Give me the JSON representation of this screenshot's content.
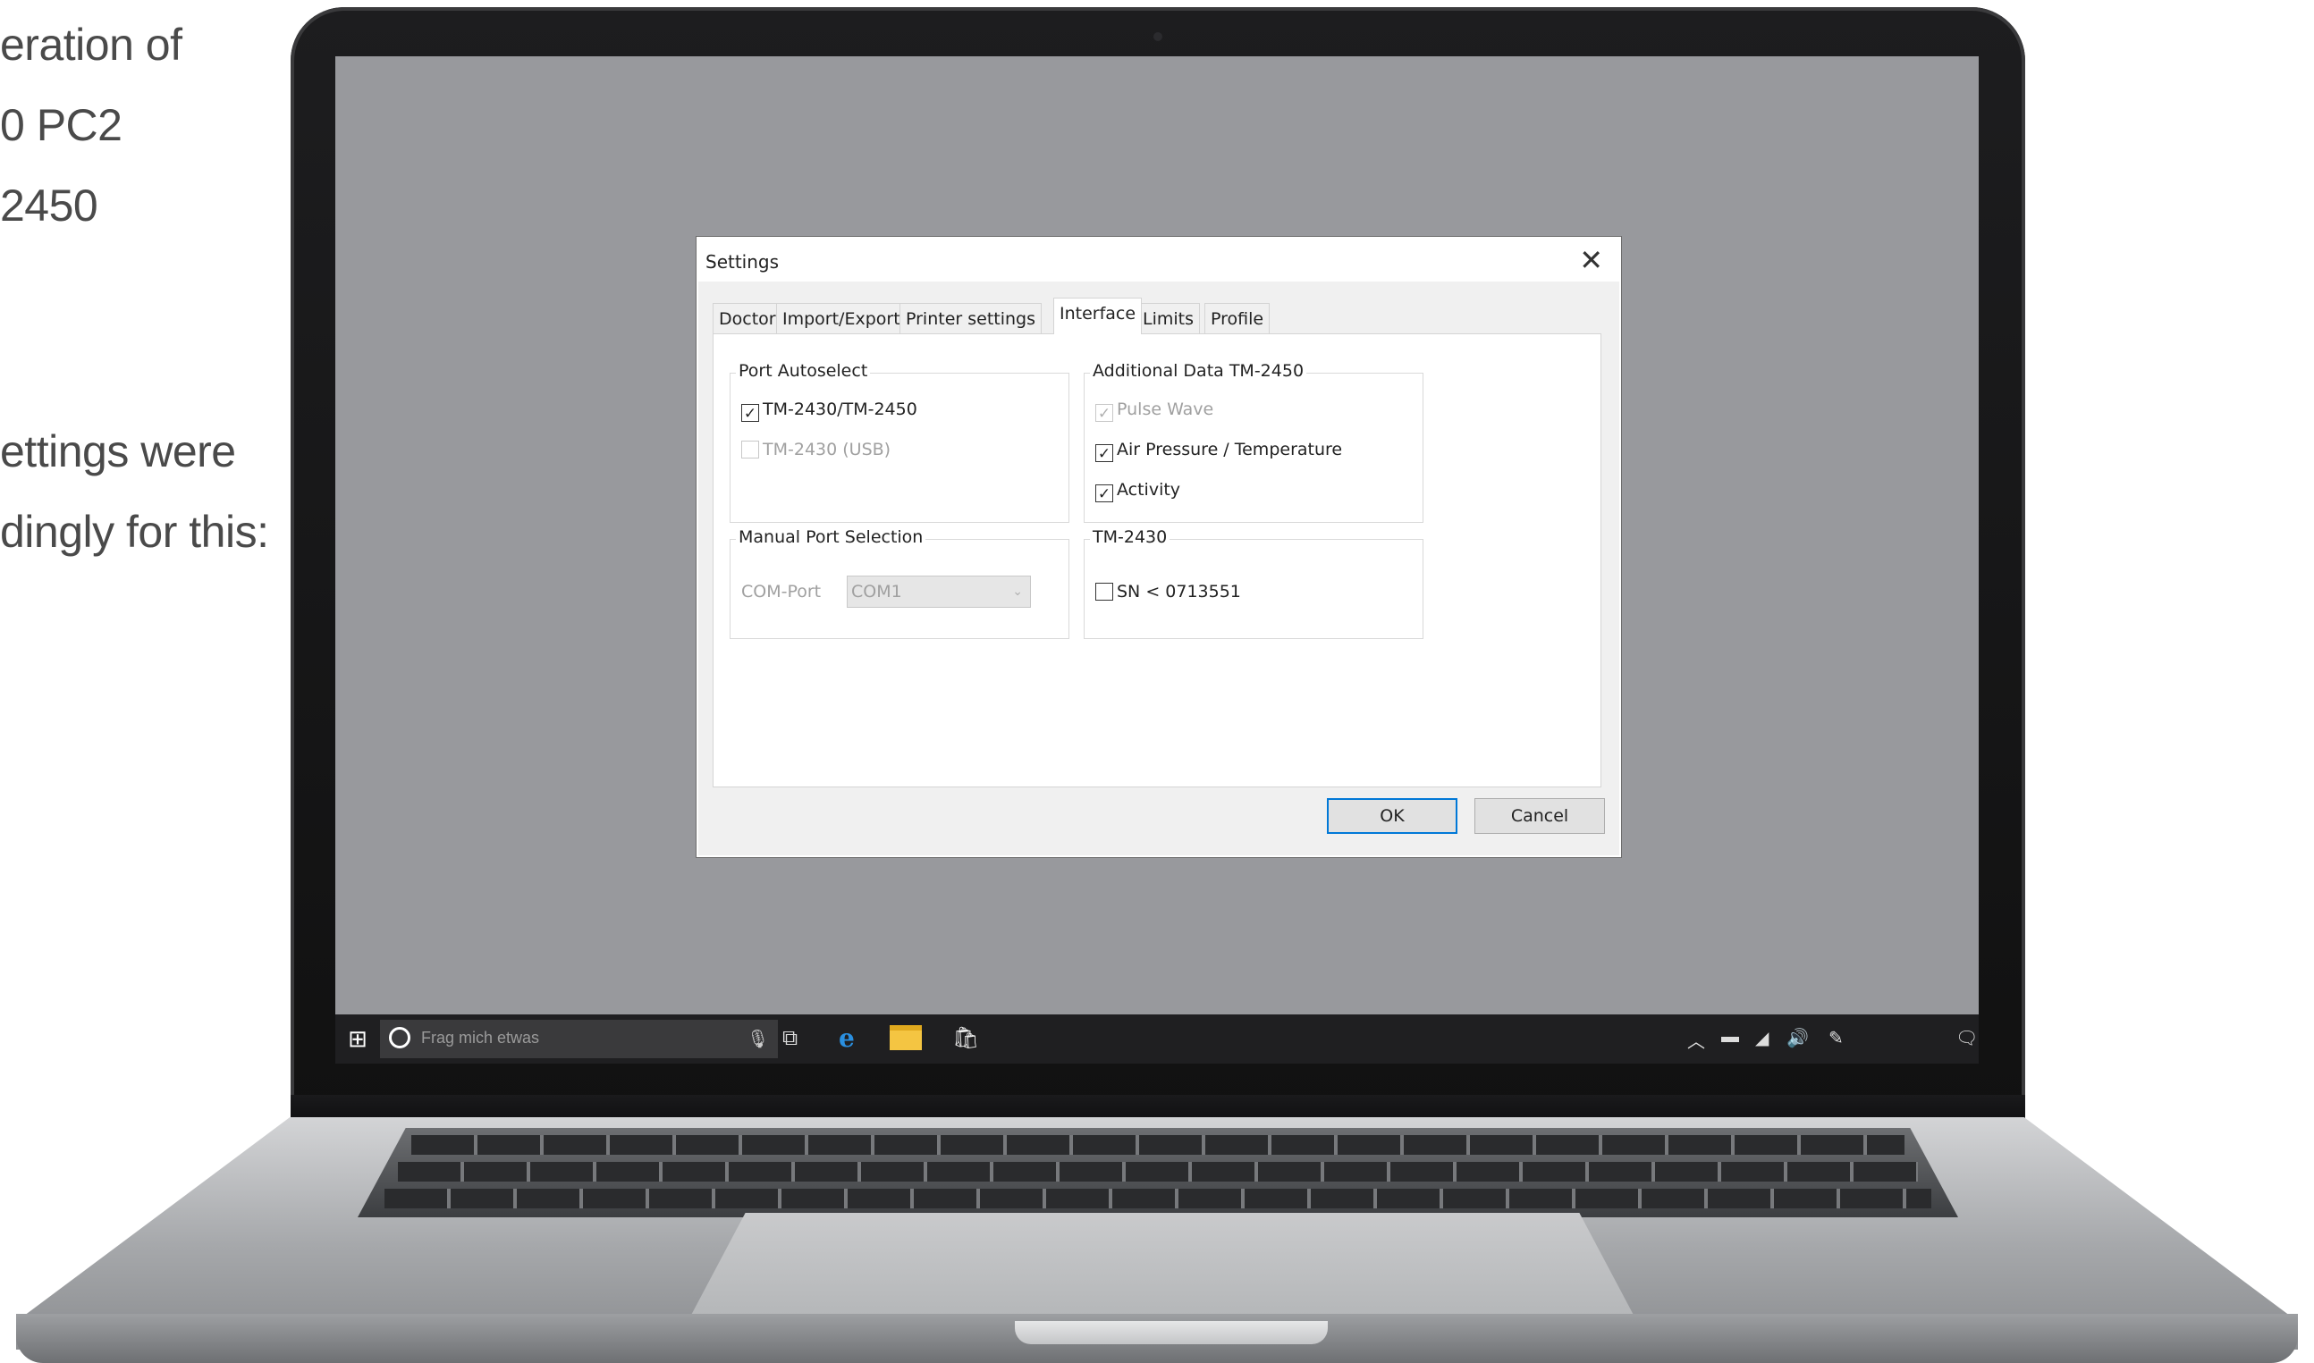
{
  "side_text": {
    "block1": [
      "eration of",
      "0 PC2",
      "2450"
    ],
    "block2": [
      "ettings were",
      "dingly for this:"
    ]
  },
  "dialog": {
    "title": "Settings",
    "close_glyph": "✕",
    "tabs": [
      {
        "label": "Doctor"
      },
      {
        "label": "Import/Export"
      },
      {
        "label": "Printer settings"
      },
      {
        "label": "Interface",
        "active": true
      },
      {
        "label": "Limits"
      },
      {
        "label": "Profile"
      }
    ],
    "port_autoselect": {
      "label": "Port Autoselect",
      "items": [
        {
          "label": "TM-2430/TM-2450",
          "checked": true,
          "enabled": true
        },
        {
          "label": "TM-2430 (USB)",
          "checked": false,
          "enabled": false
        }
      ]
    },
    "additional_data": {
      "label": "Additional Data TM-2450",
      "items": [
        {
          "label": "Pulse Wave",
          "checked": true,
          "enabled": false
        },
        {
          "label": "Air Pressure / Temperature",
          "checked": true,
          "enabled": true
        },
        {
          "label": "Activity",
          "checked": true,
          "enabled": true
        }
      ]
    },
    "manual_port": {
      "label": "Manual Port Selection",
      "com_label": "COM-Port",
      "com_value": "COM1"
    },
    "tm2430": {
      "label": "TM-2430",
      "items": [
        {
          "label": "SN < 0713551",
          "checked": false,
          "enabled": true
        }
      ]
    },
    "ok_label": "OK",
    "cancel_label": "Cancel"
  },
  "taskbar": {
    "search_placeholder": "Frag mich etwas",
    "icons": [
      "windows-start-icon",
      "cortana-icon",
      "microphone-icon",
      "task-view-icon",
      "edge-icon",
      "file-explorer-icon",
      "store-icon"
    ],
    "tray_icons": [
      "chevron-up-icon",
      "battery-icon",
      "network-icon",
      "volume-icon",
      "pen-icon",
      "notification-icon"
    ]
  },
  "colors": {
    "desktop": "#98999d",
    "accent": "#0078d7",
    "taskbar": "#1f1f21"
  }
}
